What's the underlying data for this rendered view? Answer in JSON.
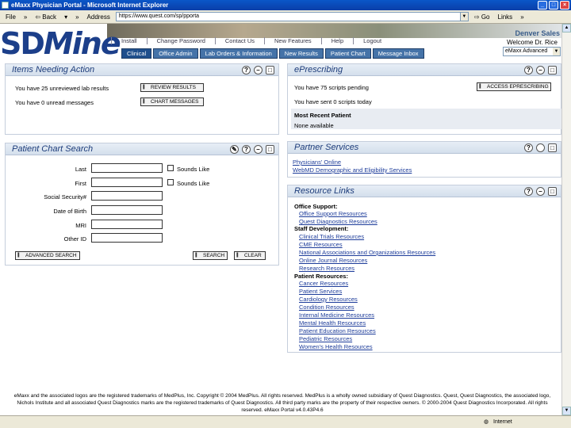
{
  "window": {
    "title": "eMaxx Physician Portal - Microsoft Internet Explorer",
    "min": "_",
    "max": "□",
    "close": "×"
  },
  "toolbar": {
    "file": "File",
    "chev1": "»",
    "back": "⇦ Back",
    "back_dd": "▾",
    "chev2": "»",
    "address_label": "Address",
    "url": "https://www.quest.com/sp/pporta",
    "go": "⇨ Go",
    "links": "Links",
    "chev3": "»"
  },
  "banner": {
    "logo_sd": "SD",
    "logo_mine": "Mine",
    "site": "Denver Sales",
    "welcome": "Welcome Dr. Rice"
  },
  "toplinks": [
    "Install",
    "Change Password",
    "Contact Us",
    "New Features",
    "Help",
    "Logout"
  ],
  "tabs": [
    "Clinical",
    "Office Admin",
    "Lab Orders & Information",
    "New Results",
    "Patient Chart",
    "Message Inbox"
  ],
  "role_select": {
    "value": "eMaxx Advanced"
  },
  "items_needing_action": {
    "title": "Items Needing Action",
    "row1_text": "You have 25 unreviewed lab results",
    "row1_btn": "REVIEW RESULTS",
    "row2_text": "You have 0 unread messages",
    "row2_btn": "CHART MESSAGES"
  },
  "eprescribing": {
    "title": "ePrescribing",
    "row1_text": "You have 75 scripts pending",
    "row1_btn": "ACCESS EPRESCRIBING",
    "row2_text": "You have sent 0 scripts today",
    "recent_head": "Most Recent Patient",
    "recent_value": "None available"
  },
  "chart_search": {
    "title": "Patient Chart Search",
    "labels": [
      "Last",
      "First",
      "Social Security#",
      "Date of Birth",
      "MRI",
      "Other ID"
    ],
    "sounds_like": "Sounds Like",
    "advanced": "ADVANCED SEARCH",
    "search": "SEARCH",
    "clear": "CLEAR"
  },
  "partner": {
    "title": "Partner Services",
    "links": [
      "Physicians' Online",
      "WebMD Demographic and Eligibility Services"
    ]
  },
  "resources": {
    "title": "Resource Links",
    "office_head": "Office Support:",
    "office": [
      "Office Support Resources",
      "Quest Diagnostics Resources"
    ],
    "staff_head": "Staff Development:",
    "staff": [
      "Clinical Trials Resources",
      "CME Resources",
      "National Associations and Organizations Resources",
      "Online Journal Resources",
      "Research Resources"
    ],
    "patient_head": "Patient Resources:",
    "patient": [
      "Cancer Resources",
      "Patient Services",
      "Cardiology Resources",
      "Condition Resources",
      "Internal Medicine Resources",
      "Mental Health Resources",
      "Patient Education Resources",
      "Pediatric Resources",
      "Women's Health Resources"
    ]
  },
  "footer": {
    "line1": "eMaxx and the associated logos are the registered trademarks of MedPlus, Inc. Copyright © 2004 MedPlus. All rights reserved. MedPlus is a wholly owned subsidiary of Quest Diagnostics. Quest, Quest Diagnostics, the associated logo,",
    "line2": "Nichols Institute and all associated Quest Diagnostics marks are the registered trademarks of Quest Diagnostics. All third party marks are the property of their respective owners. © 2000-2004 Quest Diagnostics Incorporated. All rights",
    "line3": "reserved. eMaxx Portal v4.0.43P4.6"
  },
  "status": {
    "zone": "Internet"
  }
}
